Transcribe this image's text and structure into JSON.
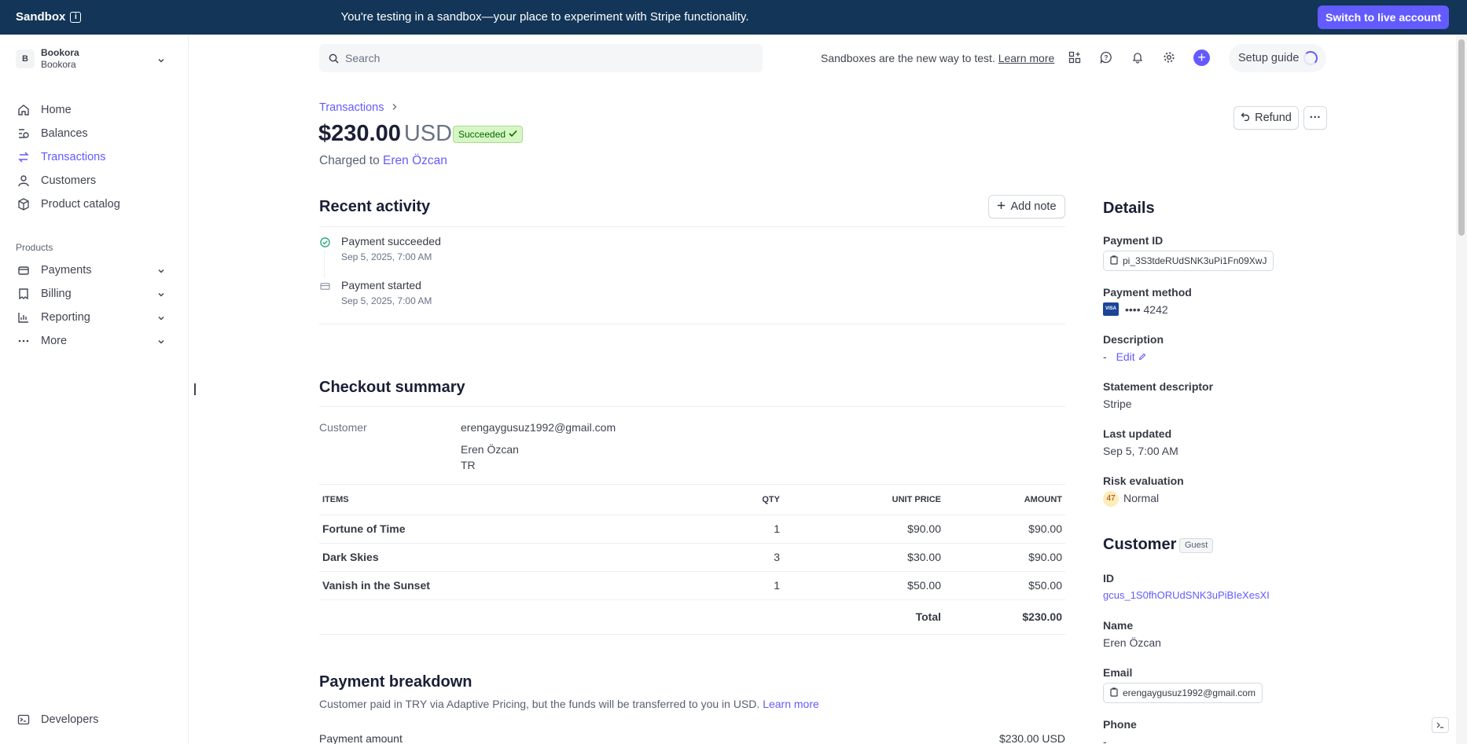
{
  "banner": {
    "brand": "Sandbox",
    "message": "You're testing in a sandbox—your place to experiment with Stripe functionality.",
    "live_button": "Switch to live account"
  },
  "account": {
    "initial": "B",
    "name": "Bookora",
    "sub": "Bookora"
  },
  "sidebar": {
    "items": [
      {
        "label": "Home",
        "icon": "home-icon"
      },
      {
        "label": "Balances",
        "icon": "balances-icon"
      },
      {
        "label": "Transactions",
        "icon": "transactions-icon",
        "active": true
      },
      {
        "label": "Customers",
        "icon": "customers-icon"
      },
      {
        "label": "Product catalog",
        "icon": "product-catalog-icon"
      }
    ],
    "section_label": "Products",
    "product_items": [
      {
        "label": "Payments",
        "icon": "payments-icon"
      },
      {
        "label": "Billing",
        "icon": "billing-icon"
      },
      {
        "label": "Reporting",
        "icon": "reporting-icon"
      },
      {
        "label": "More",
        "icon": "more-dots-icon"
      }
    ],
    "developers": "Developers"
  },
  "header": {
    "search_placeholder": "Search",
    "note": "Sandboxes are the new way to test.",
    "note_link": "Learn more",
    "setup_guide": "Setup guide"
  },
  "payment": {
    "breadcrumb": "Transactions",
    "amount": "$230.00",
    "currency": "USD",
    "status": "Succeeded",
    "charged_prefix": "Charged to",
    "customer_name": "Eren Özcan",
    "refund_label": "Refund",
    "more_label": "···"
  },
  "activity": {
    "title": "Recent activity",
    "add_note": "Add note",
    "events": [
      {
        "title": "Payment succeeded",
        "date": "Sep 5, 2025, 7:00 AM"
      },
      {
        "title": "Payment started",
        "date": "Sep 5, 2025, 7:00 AM"
      }
    ]
  },
  "checkout": {
    "title": "Checkout summary",
    "customer_label": "Customer",
    "customer_email": "erengaygusuz1992@gmail.com",
    "customer_name": "Eren Özcan",
    "customer_country": "TR",
    "columns": [
      "ITEMS",
      "QTY",
      "UNIT PRICE",
      "AMOUNT"
    ],
    "items": [
      {
        "name": "Fortune of Time",
        "qty": "1",
        "unit": "$90.00",
        "amount": "$90.00"
      },
      {
        "name": "Dark Skies",
        "qty": "3",
        "unit": "$30.00",
        "amount": "$90.00"
      },
      {
        "name": "Vanish in the Sunset",
        "qty": "1",
        "unit": "$50.00",
        "amount": "$50.00"
      }
    ],
    "total_label": "Total",
    "total": "$230.00"
  },
  "breakdown": {
    "title": "Payment breakdown",
    "description": "Customer paid in TRY via Adaptive Pricing, but the funds will be transferred to you in USD.",
    "description_link": "Learn more",
    "row_label": "Payment amount",
    "row_value": "$230.00 USD"
  },
  "details": {
    "title": "Details",
    "payment_id_label": "Payment ID",
    "payment_id": "pi_3S3tdeRUdSNK3uPi1Fn09XwJ",
    "method_label": "Payment method",
    "card_brand": "VISA",
    "card_last4": "•••• 4242",
    "description_label": "Description",
    "description_value": "-",
    "description_edit": "Edit",
    "statement_label": "Statement descriptor",
    "statement_value": "Stripe",
    "updated_label": "Last updated",
    "updated_value": "Sep 5, 7:00 AM",
    "risk_label": "Risk evaluation",
    "risk_score": "47",
    "risk_level": "Normal"
  },
  "customer": {
    "title": "Customer",
    "badge": "Guest",
    "id_label": "ID",
    "id_value": "gcus_1S0fhORUdSNK3uPiBIeXesXI",
    "name_label": "Name",
    "name_value": "Eren Özcan",
    "email_label": "Email",
    "email_value": "erengaygusuz1992@gmail.com",
    "phone_label": "Phone",
    "phone_value": "-"
  },
  "colors": {
    "accent": "#635bff",
    "banner_bg": "#133658",
    "success_bg": "#d7f7c2",
    "success_text": "#006908"
  }
}
